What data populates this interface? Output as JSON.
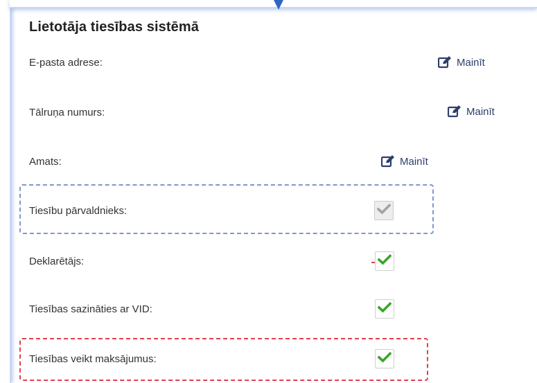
{
  "panel": {
    "title": "Lietotāja tiesības sistēmā"
  },
  "fields": [
    {
      "label": "E-pasta adrese:",
      "action": "Mainīt"
    },
    {
      "label": "Tālruņa numurs:",
      "action": "Mainīt"
    },
    {
      "label": "Amats:",
      "action": "Mainīt"
    }
  ],
  "permissions": [
    {
      "label": "Tiesību pārvaldnieks:",
      "checked": true,
      "disabled": true
    },
    {
      "label": "Deklarētājs:",
      "checked": true,
      "disabled": false
    },
    {
      "label": "Tiesības sazināties ar VID:",
      "checked": true,
      "disabled": false
    },
    {
      "label": "Tiesības veikt maksājumus:",
      "checked": true,
      "disabled": false
    }
  ],
  "icons": {
    "edit": "edit-icon",
    "check": "checkmark-icon"
  },
  "colors": {
    "check_enabled": "#3aa52a",
    "check_disabled": "#a3a3a3",
    "link": "#2c3e6b",
    "highlight_blue": "#7d98c8",
    "highlight_red": "#e0404a",
    "marker": "#2f66c4"
  }
}
